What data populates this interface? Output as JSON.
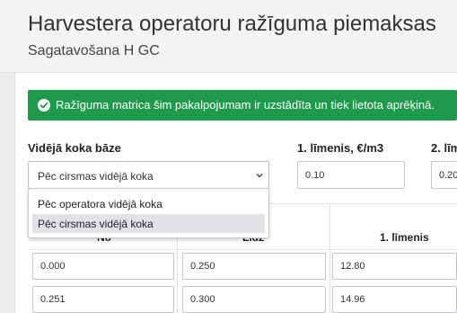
{
  "header": {
    "title": "Harvestera operatoru ražīguma piemaksas",
    "subtitle": "Sagatavošana H GC"
  },
  "alert": {
    "icon": "check-circle-icon",
    "text": "Ražīguma matrica šim pakalpojumam ir uzstādīta un tiek lietota aprēķinā.",
    "color": "#1f9a4c"
  },
  "form": {
    "avg_base_label": "Vidējā koka bāze",
    "avg_base_value": "Pēc cirsmas vidējā koka",
    "avg_base_options": [
      "Pēc operatora vidējā koka",
      "Pēc cirsmas vidējā koka"
    ],
    "level1_label": "1. līmenis, €/m3",
    "level1_value": "0.10",
    "level2_label": "2. līm",
    "level2_value": "0.20"
  },
  "table": {
    "headers": [
      "No",
      "Līdz",
      "1. līmenis"
    ],
    "rows": [
      [
        "0.000",
        "0.250",
        "12.80"
      ],
      [
        "0.251",
        "0.300",
        "14.96"
      ]
    ]
  }
}
